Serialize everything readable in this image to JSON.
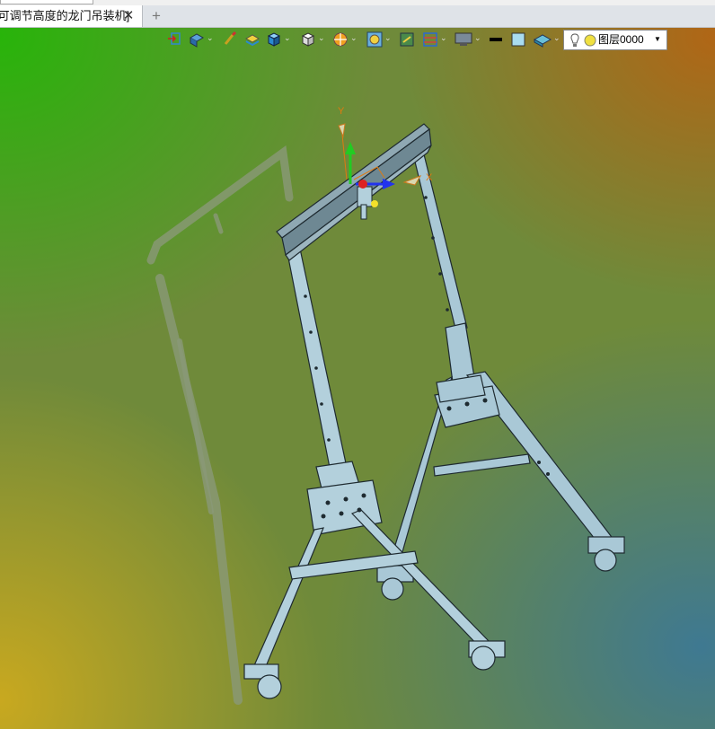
{
  "window": {
    "tab_title": "[可调节高度的龙门吊装机]",
    "tab_close": "✕",
    "new_tab": "+"
  },
  "toolbar": {
    "icons": [
      "exit-view-icon",
      "render-style-icon",
      "brush-icon",
      "layers-cube-icon",
      "solid-cube-icon",
      "view-cube-icon",
      "section-icon",
      "zoom-icon",
      "fit-icon",
      "grid-icon",
      "display-icon",
      "line-color-icon",
      "fill-color-icon",
      "surface-icon"
    ],
    "layer_selector": {
      "label": "图层0000"
    }
  },
  "scene": {
    "axis_labels": {
      "y": "Y",
      "x": "X"
    },
    "colors": {
      "frame": "#a9c8d6",
      "frame_edge": "#2a3a40",
      "beam": "#8fa8b3",
      "axis_y": "#22cc22",
      "axis_x": "#2233ee",
      "axis_z": "#dd2222",
      "shadow": "#8a9a7a"
    }
  }
}
